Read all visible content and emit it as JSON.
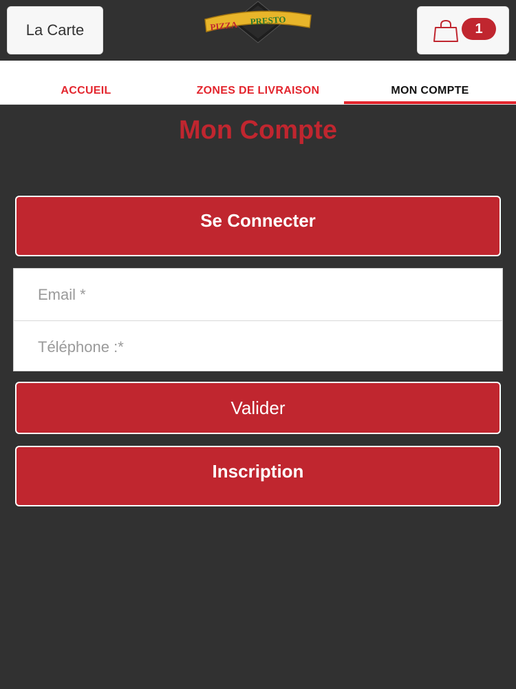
{
  "header": {
    "menu_label": "La Carte",
    "logo_text_left": "PIZZA",
    "logo_text_right": "PRESTO",
    "cart_count": "1"
  },
  "tabs": [
    {
      "label": "ACCUEIL",
      "active": false
    },
    {
      "label": "ZONES DE LIVRAISON",
      "active": false
    },
    {
      "label": "MON COMPTE",
      "active": true
    }
  ],
  "page": {
    "title": "Mon Compte"
  },
  "login": {
    "connect_label": "Se Connecter",
    "email_placeholder": "Email *",
    "phone_placeholder": "Téléphone :*",
    "submit_label": "Valider",
    "signup_label": "Inscription"
  },
  "colors": {
    "accent": "#c0262f",
    "tab_accent": "#e3262e",
    "background": "#313131"
  }
}
